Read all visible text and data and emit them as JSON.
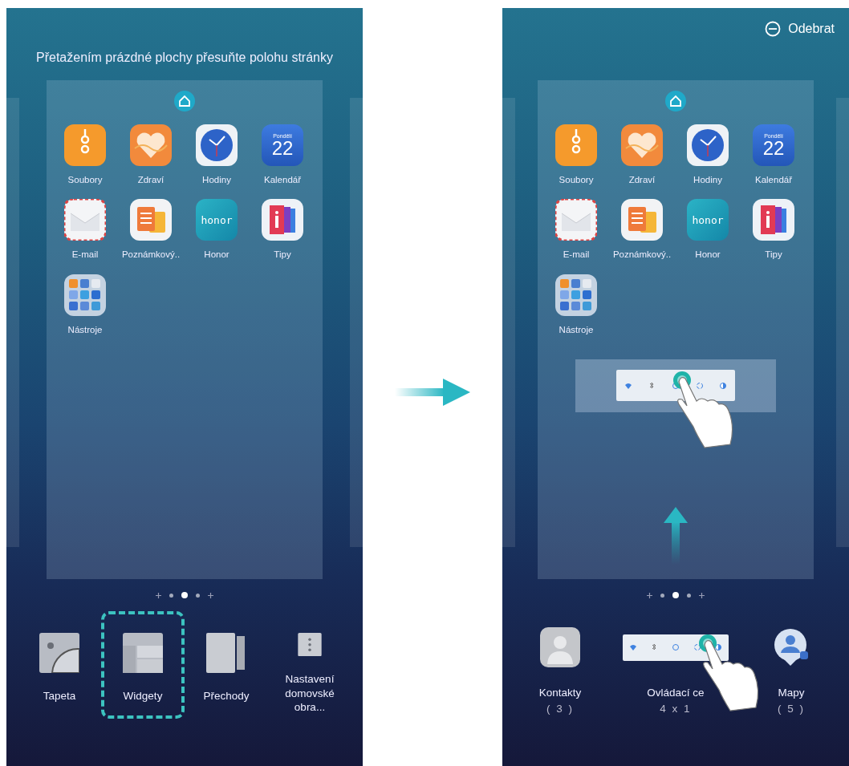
{
  "screens": [
    {
      "hint": "Přetažením prázdné plochy přesuňte polohu stránky",
      "apps": [
        {
          "kind": "files",
          "label": "Soubory"
        },
        {
          "kind": "health",
          "label": "Zdraví"
        },
        {
          "kind": "clock",
          "label": "Hodiny"
        },
        {
          "kind": "calendar",
          "label": "Kalendář",
          "day": "Pondělí",
          "date": "22"
        },
        {
          "kind": "mail",
          "label": "E-mail"
        },
        {
          "kind": "notes",
          "label": "Poznámkový.."
        },
        {
          "kind": "honor",
          "label": "Honor",
          "logo_text": "honor"
        },
        {
          "kind": "tips",
          "label": "Tipy"
        },
        {
          "kind": "folder",
          "label": "Nástroje"
        }
      ],
      "page_dots": [
        {
          "kind": "plus",
          "selected": false
        },
        {
          "kind": "dot",
          "selected": false
        },
        {
          "kind": "dot",
          "selected": true
        },
        {
          "kind": "dot",
          "selected": false
        },
        {
          "kind": "plus",
          "selected": false
        }
      ],
      "bottom_menu": [
        {
          "kind": "wallpaper",
          "label": "Tapeta",
          "selected": false
        },
        {
          "kind": "widgets",
          "label": "Widgety",
          "selected": true
        },
        {
          "kind": "transitions",
          "label": "Přechody",
          "selected": false
        },
        {
          "kind": "settings",
          "label": "Nastavení domovské obra..."
        }
      ]
    },
    {
      "action": {
        "label": "Odebrat"
      },
      "apps": [
        {
          "kind": "files",
          "label": "Soubory"
        },
        {
          "kind": "health",
          "label": "Zdraví"
        },
        {
          "kind": "clock",
          "label": "Hodiny"
        },
        {
          "kind": "calendar",
          "label": "Kalendář",
          "day": "Pondělí",
          "date": "22"
        },
        {
          "kind": "mail",
          "label": "E-mail"
        },
        {
          "kind": "notes",
          "label": "Poznámkový.."
        },
        {
          "kind": "honor",
          "label": "Honor",
          "logo_text": "honor"
        },
        {
          "kind": "tips",
          "label": "Tipy"
        },
        {
          "kind": "folder",
          "label": "Nástroje"
        }
      ],
      "widget_preview": {
        "tiles": [
          {
            "kind": "wifi"
          },
          {
            "kind": "bluetooth"
          },
          {
            "kind": "data"
          },
          {
            "kind": "sync"
          },
          {
            "kind": "brightness"
          }
        ]
      },
      "page_dots": [
        {
          "kind": "plus",
          "selected": false
        },
        {
          "kind": "dot",
          "selected": false
        },
        {
          "kind": "dot",
          "selected": true
        },
        {
          "kind": "dot",
          "selected": false
        },
        {
          "kind": "plus",
          "selected": false
        }
      ],
      "widget_list": [
        {
          "kind": "contacts",
          "label": "Kontakty",
          "count": "( 3 )"
        },
        {
          "kind": "widget",
          "label": "Ovládací ce",
          "count": "4 x 1",
          "tiles": [
            {
              "kind": "wifi"
            },
            {
              "kind": "bluetooth"
            },
            {
              "kind": "data"
            },
            {
              "kind": "sync"
            },
            {
              "kind": "brightness"
            }
          ]
        },
        {
          "kind": "maps",
          "label": "Mapy",
          "count": "( 5 )"
        }
      ]
    }
  ]
}
